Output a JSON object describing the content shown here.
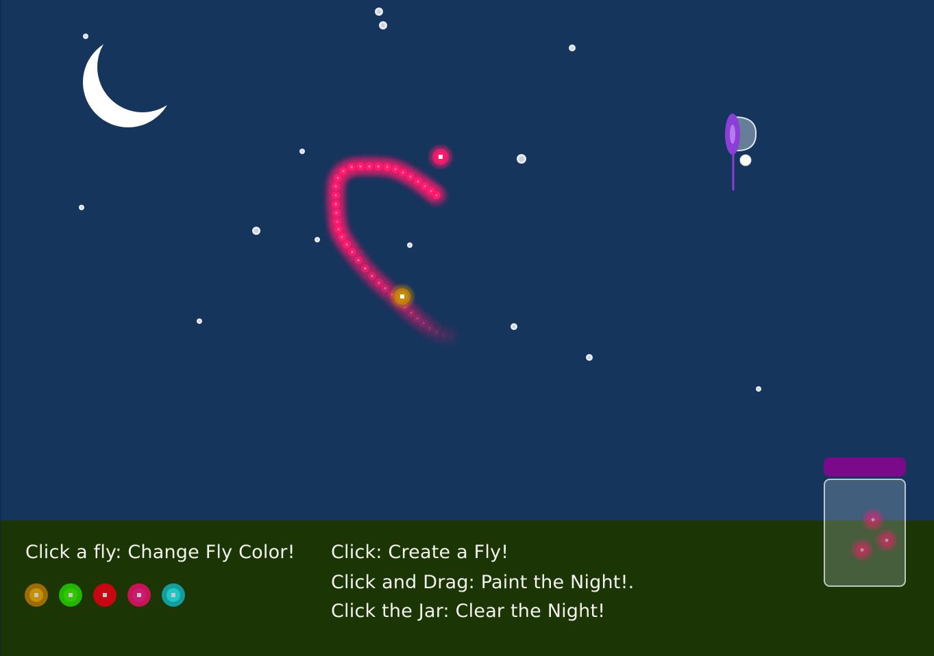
{
  "game": {
    "instructions": {
      "change_color": "Click a fly: Change Fly Color!",
      "create": "Click: Create a Fly!",
      "paint": "Click and Drag: Paint the Night!.",
      "clear": "Click the Jar: Clear the Night!"
    },
    "fly_colors": [
      {
        "name": "orange",
        "color": "#c98a05"
      },
      {
        "name": "green",
        "color": "#2ee800"
      },
      {
        "name": "red",
        "color": "#ff0814"
      },
      {
        "name": "pink",
        "color": "#ff1a6e"
      },
      {
        "name": "teal",
        "color": "#1cc8c8"
      }
    ],
    "palette": {
      "sky": "#16355c",
      "ground": "#1c3504",
      "moon": "#ffffff",
      "jar_lid": "#7a0a8a",
      "net": "#8b3fd6",
      "trail": "#ff1a6e"
    },
    "jar_fly_count": 3,
    "icons": [
      "moon-icon",
      "net-icon",
      "jar-icon",
      "firefly-icon",
      "star-icon"
    ]
  }
}
